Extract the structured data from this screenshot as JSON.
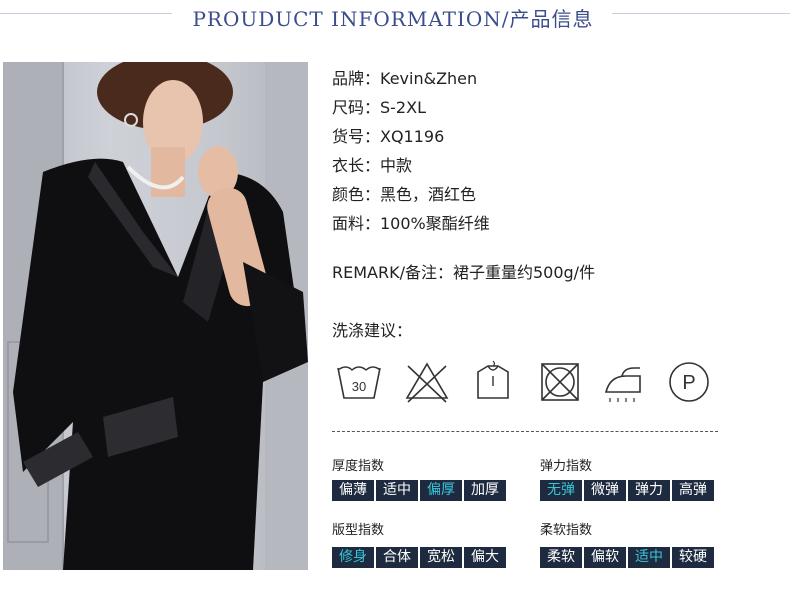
{
  "header": {
    "title": "PROUDUCT INFORMATION/产品信息"
  },
  "info": [
    "品牌：Kevin&Zhen",
    "尺码：S-2XL",
    "货号：XQ1196",
    "衣长：中款",
    "颜色：黑色，酒红色",
    "面料：100%聚酯纤维"
  ],
  "remark": "REMARK/备注：裙子重量约500g/件",
  "wash": {
    "title": "洗涤建议：",
    "icons": [
      {
        "name": "wash-30-icon",
        "label": "30"
      },
      {
        "name": "no-bleach-icon"
      },
      {
        "name": "hang-dry-icon"
      },
      {
        "name": "no-tumble-dry-icon"
      },
      {
        "name": "iron-icon"
      },
      {
        "name": "dry-clean-p-icon",
        "label": "P"
      }
    ]
  },
  "indices": {
    "thickness": {
      "label": "厚度指数",
      "options": [
        "偏薄",
        "适中",
        "偏厚",
        "加厚"
      ],
      "selected": 2
    },
    "elasticity": {
      "label": "弹力指数",
      "options": [
        "无弹",
        "微弹",
        "弹力",
        "高弹"
      ],
      "selected": 0
    },
    "fit": {
      "label": "版型指数",
      "options": [
        "修身",
        "合体",
        "宽松",
        "偏大"
      ],
      "selected": 0
    },
    "softness": {
      "label": "柔软指数",
      "options": [
        "柔软",
        "偏软",
        "适中",
        "较硬"
      ],
      "selected": 2
    }
  },
  "colors": {
    "accent": "#3b4c8c",
    "cell_bg": "#1d2a3f",
    "selected_text": "#37c6d8"
  }
}
